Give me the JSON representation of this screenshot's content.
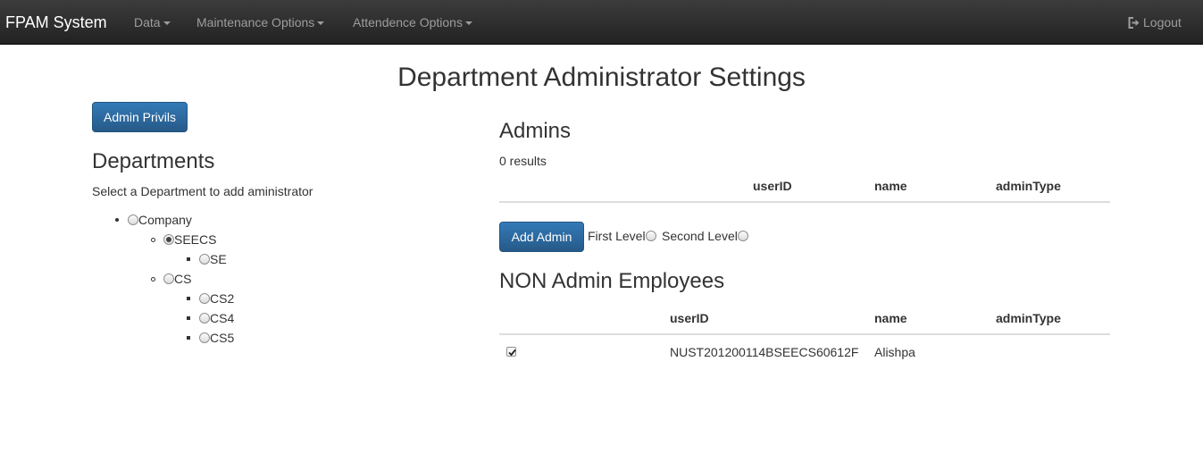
{
  "navbar": {
    "brand": "FPAM System",
    "menus": [
      "Data",
      "Maintenance Options",
      "Attendence Options"
    ],
    "logout": "Logout"
  },
  "page_title": "Department Administrator Settings",
  "left": {
    "admin_privils_button": "Admin Privils",
    "departments_heading": "Departments",
    "hint": "Select a Department to add aministrator",
    "tree": {
      "company": "Company",
      "seecs": "SEECS",
      "se": "SE",
      "cs": "CS",
      "cs2": "CS2",
      "cs4": "CS4",
      "cs5": "CS5",
      "selected": "SEECS"
    }
  },
  "admins": {
    "heading": "Admins",
    "count": "0 results",
    "columns": [
      "userID",
      "name",
      "adminType"
    ],
    "rows": []
  },
  "add_admin": {
    "button": "Add Admin",
    "first_level": "First Level",
    "second_level": "Second Level"
  },
  "non_admin": {
    "heading": "NON Admin Employees",
    "columns": [
      "userID",
      "name",
      "adminType"
    ],
    "rows": [
      {
        "checked": true,
        "userID": "NUST201200114BSEECS60612F",
        "name": "Alishpa",
        "adminType": ""
      }
    ]
  },
  "colors": {
    "navbar": "#222222",
    "primary": "#337ab7",
    "text": "#333333",
    "nav_text": "#9d9d9d"
  }
}
